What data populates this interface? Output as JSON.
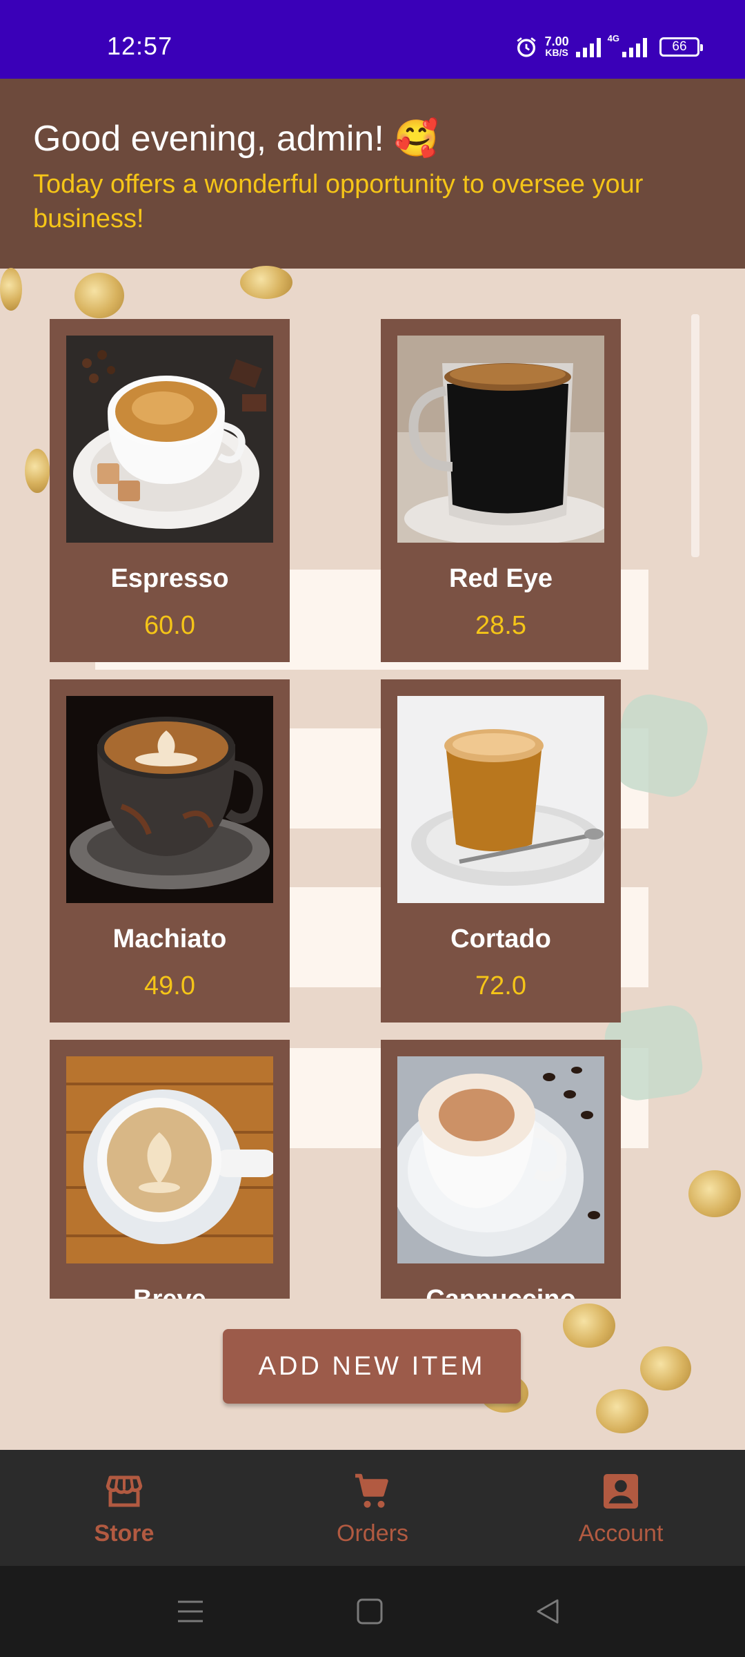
{
  "status_bar": {
    "time": "12:57",
    "net_speed": "7.00",
    "net_unit": "KB/S",
    "network_type": "4G",
    "battery": "66"
  },
  "header": {
    "greeting": "Good evening, admin! 🥰",
    "subtitle": "Today offers a wonderful opportunity to oversee your business!"
  },
  "products": [
    {
      "name": "Espresso",
      "price": "60.0"
    },
    {
      "name": "Red Eye",
      "price": "28.5"
    },
    {
      "name": "Machiato",
      "price": "49.0"
    },
    {
      "name": "Cortado",
      "price": "72.0"
    },
    {
      "name": "Breve",
      "price": ""
    },
    {
      "name": "Cappuccino",
      "price": ""
    }
  ],
  "add_button": {
    "label": "ADD NEW ITEM"
  },
  "bottom_nav": {
    "items": [
      {
        "label": "Store",
        "icon": "store-icon",
        "active": true
      },
      {
        "label": "Orders",
        "icon": "cart-icon",
        "active": false
      },
      {
        "label": "Account",
        "icon": "account-icon",
        "active": false
      }
    ]
  },
  "colors": {
    "status_bar": "#3a00b8",
    "header": "#6d4a3c",
    "card": "#7b5244",
    "price": "#f5c518",
    "accent": "#b25a41",
    "button": "#9c5b4a"
  }
}
